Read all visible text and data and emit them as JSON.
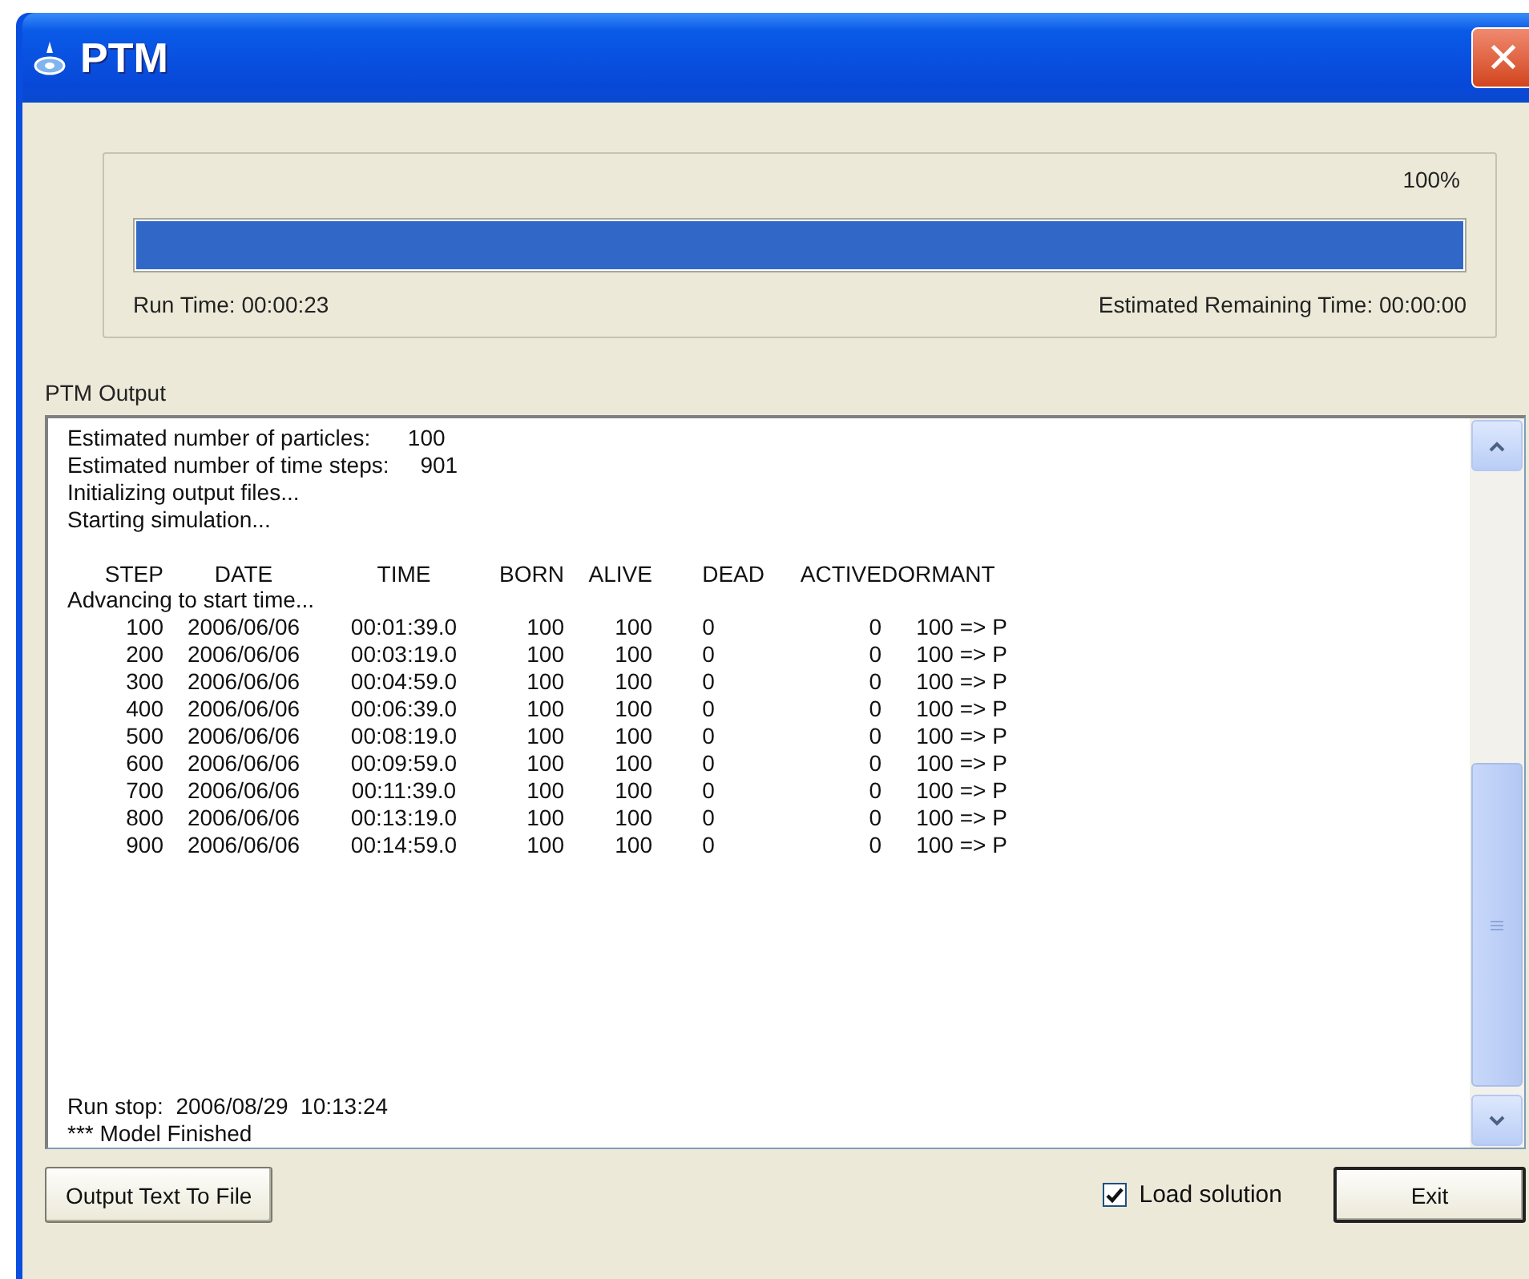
{
  "window": {
    "title": "PTM",
    "close_label": "✕"
  },
  "progress": {
    "percent": "100%",
    "level": 1,
    "run_time": "Run Time: 00:00:23",
    "remaining_time": "Estimated Remaining Time: 00:00:00"
  },
  "output": {
    "label": "PTM Output",
    "intro_lines": [
      "Estimated number of particles:      100",
      "Estimated number of time steps:     901",
      "Initializing output files...",
      "Starting simulation..."
    ],
    "table": {
      "columns": [
        "STEP",
        "DATE",
        "TIME",
        "BORN",
        "ALIVE",
        "DEAD",
        "ACTIVE",
        "DORMANT"
      ],
      "note": "Advancing to start time...",
      "rows": [
        [
          "100",
          "2006/06/06",
          "00:01:39.0",
          "100",
          "100",
          "0",
          "0",
          "100 => P"
        ],
        [
          "200",
          "2006/06/06",
          "00:03:19.0",
          "100",
          "100",
          "0",
          "0",
          "100 => P"
        ],
        [
          "300",
          "2006/06/06",
          "00:04:59.0",
          "100",
          "100",
          "0",
          "0",
          "100 => P"
        ],
        [
          "400",
          "2006/06/06",
          "00:06:39.0",
          "100",
          "100",
          "0",
          "0",
          "100 => P"
        ],
        [
          "500",
          "2006/06/06",
          "00:08:19.0",
          "100",
          "100",
          "0",
          "0",
          "100 => P"
        ],
        [
          "600",
          "2006/06/06",
          "00:09:59.0",
          "100",
          "100",
          "0",
          "0",
          "100 => P"
        ],
        [
          "700",
          "2006/06/06",
          "00:11:39.0",
          "100",
          "100",
          "0",
          "0",
          "100 => P"
        ],
        [
          "800",
          "2006/06/06",
          "00:13:19.0",
          "100",
          "100",
          "0",
          "0",
          "100 => P"
        ],
        [
          "900",
          "2006/06/06",
          "00:14:59.0",
          "100",
          "100",
          "0",
          "0",
          "100 => P"
        ]
      ]
    },
    "footer_lines": [
      "Run stop:  2006/08/29  10:13:24",
      "*** Model Finished"
    ]
  },
  "buttons": {
    "output_to_file": "Output Text To File",
    "exit": "Exit"
  },
  "load_solution": {
    "label": "Load solution",
    "checked": true
  }
}
